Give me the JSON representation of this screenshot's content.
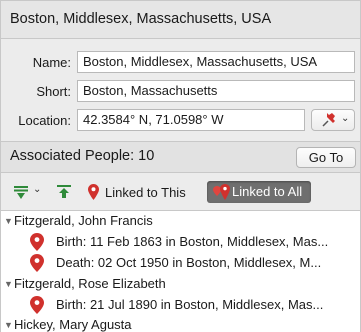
{
  "header": {
    "title": "Boston, Middlesex, Massachusetts, USA"
  },
  "fields": {
    "name_label": "Name:",
    "name_value": "Boston, Middlesex, Massachusetts, USA",
    "short_label": "Short:",
    "short_value": "Boston, Massachusetts",
    "location_label": "Location:",
    "location_value": "42.3584° N, 71.0598° W"
  },
  "associated": {
    "title": "Associated People: 10",
    "goto_label": "Go To"
  },
  "toolbar": {
    "linked_to_this_label": "Linked to This",
    "linked_to_all_label": "Linked to All",
    "linked_to_all_selected": true
  },
  "people": [
    {
      "name": "Fitzgerald, John Francis",
      "events": [
        "Birth: 11 Feb 1863 in Boston, Middlesex, Mas...",
        "Death: 02 Oct 1950 in Boston, Middlesex, M..."
      ]
    },
    {
      "name": "Fitzgerald, Rose Elizabeth",
      "events": [
        "Birth: 21 Jul 1890 in Boston, Middlesex, Mas..."
      ]
    },
    {
      "name": "Hickey, Mary Agusta",
      "events": []
    }
  ],
  "colors": {
    "pin_red": "#d0312d",
    "arrow_green": "#2f8a3a",
    "selected_segment": "#6f6f6f"
  },
  "icons": {
    "pin": "map-pin-icon",
    "export": "export-arrow-icon",
    "import": "import-arrow-icon"
  }
}
